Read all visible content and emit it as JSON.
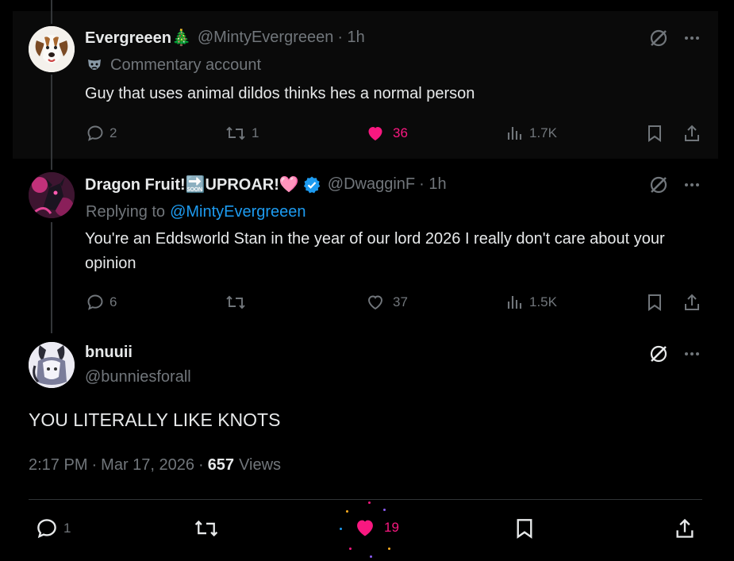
{
  "tweets": [
    {
      "name": "Evergreeen🎄",
      "handle": "@MintyEvergreeen",
      "time": "· 1h",
      "badge_icon": "theater-mask-icon",
      "sub_label": "Commentary account",
      "text": "Guy that uses animal dildos thinks hes a normal person",
      "replies": "2",
      "reposts": "1",
      "likes": "36",
      "liked": true,
      "views": "1.7K"
    },
    {
      "name": "Dragon Fruit!🔜UPROAR!🩷",
      "handle": "@DwagginF",
      "time": "· 1h",
      "verified": true,
      "reply_prefix": "Replying to",
      "reply_to": "@MintyEvergreeen",
      "text": "You're an Eddsworld Stan in the year of our lord 2026 I really don't care about your opinion",
      "replies": "6",
      "reposts": "",
      "likes": "37",
      "liked": false,
      "views": "1.5K"
    }
  ],
  "main": {
    "name": "bnuuii",
    "handle": "@bunniesforall",
    "text": "YOU LITERALLY LIKE KNOTS",
    "time": "2:17 PM",
    "date": "Mar 17, 2026",
    "views_count": "657",
    "views_label": "Views",
    "replies": "1",
    "reposts": "",
    "likes": "19",
    "liked": true
  },
  "colors": {
    "background": "#000000",
    "text": "#e7e9ea",
    "muted": "#71767b",
    "like": "#f91880",
    "link": "#1d9bf0"
  }
}
